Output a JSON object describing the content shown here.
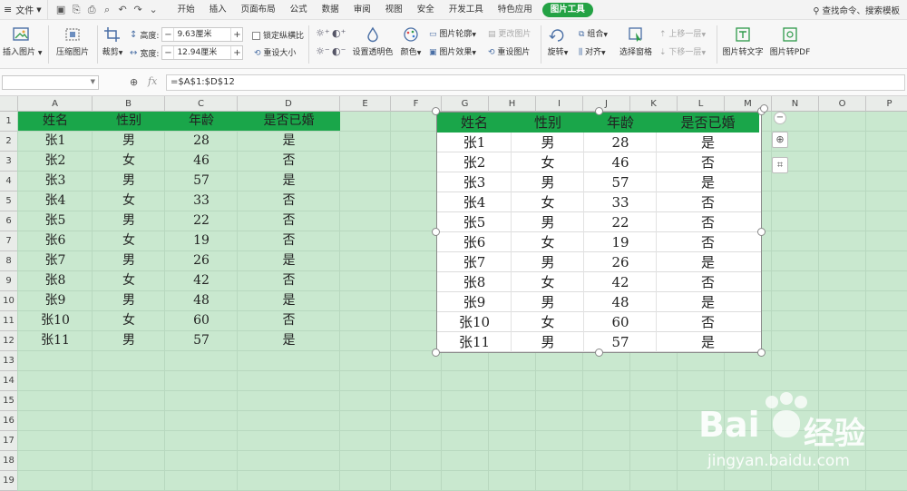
{
  "menubar": {
    "file_label": "文件",
    "tabs": [
      "开始",
      "插入",
      "页面布局",
      "公式",
      "数据",
      "审阅",
      "视图",
      "安全",
      "开发工具",
      "特色应用",
      "图片工具"
    ],
    "active_tab": "图片工具",
    "search_label": "查找命令、搜索模板"
  },
  "ribbon": {
    "insert_picture": "插入图片",
    "compress_picture": "压缩图片",
    "crop": "裁剪",
    "height_label": "高度:",
    "height_value": "9.63厘米",
    "width_label": "宽度:",
    "width_value": "12.94厘米",
    "lock_ratio": "锁定纵横比",
    "reset_size": "重设大小",
    "set_transparent": "设置透明色",
    "color": "颜色",
    "picture_outline": "图片轮廓",
    "picture_effect": "图片效果",
    "change_picture": "更改图片",
    "reset_picture": "重设图片",
    "rotate": "旋转",
    "group": "组合",
    "align": "对齐",
    "bring_forward": "上移一层",
    "send_backward": "下移一层",
    "select_pane": "选择窗格",
    "picture_to_text": "图片转文字",
    "picture_to_pdf": "图片转PDF"
  },
  "formula": {
    "fx": "fx",
    "content": "=$A$1:$D$12"
  },
  "sheet": {
    "columns": [
      "A",
      "B",
      "C",
      "D",
      "E",
      "F",
      "G",
      "H",
      "I",
      "J",
      "K",
      "L",
      "M",
      "N",
      "O",
      "P"
    ],
    "rows": [
      "1",
      "2",
      "3",
      "4",
      "5",
      "6",
      "7",
      "8",
      "9",
      "10",
      "11",
      "12",
      "13",
      "14",
      "15",
      "16",
      "17",
      "18",
      "19"
    ],
    "table": {
      "headers": [
        "姓名",
        "性别",
        "年龄",
        "是否已婚"
      ],
      "rows": [
        [
          "张1",
          "男",
          "28",
          "是"
        ],
        [
          "张2",
          "女",
          "46",
          "否"
        ],
        [
          "张3",
          "男",
          "57",
          "是"
        ],
        [
          "张4",
          "女",
          "33",
          "否"
        ],
        [
          "张5",
          "男",
          "22",
          "否"
        ],
        [
          "张6",
          "女",
          "19",
          "否"
        ],
        [
          "张7",
          "男",
          "26",
          "是"
        ],
        [
          "张8",
          "女",
          "42",
          "否"
        ],
        [
          "张9",
          "男",
          "48",
          "是"
        ],
        [
          "张10",
          "女",
          "60",
          "否"
        ],
        [
          "张11",
          "男",
          "57",
          "是"
        ]
      ]
    }
  },
  "colors": {
    "accent": "#23a244",
    "header_fill": "#1aa64a",
    "sheet_bg": "#c9e8cf"
  },
  "watermark": {
    "brand": "Bai",
    "brand_cn": "经验",
    "url": "jingyan.baidu.com"
  }
}
